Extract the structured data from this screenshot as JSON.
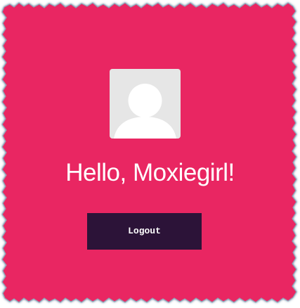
{
  "colors": {
    "card_background": "#e92862",
    "card_edge": "#8fa4b8",
    "avatar_background": "#e6e6e6",
    "avatar_silhouette": "#ffffff",
    "button_background": "#2c1338",
    "text": "#ffffff"
  },
  "profile": {
    "avatar_icon": "default-user-icon",
    "greeting": "Hello, Moxiegirl!"
  },
  "actions": {
    "logout_label": "Logout"
  }
}
